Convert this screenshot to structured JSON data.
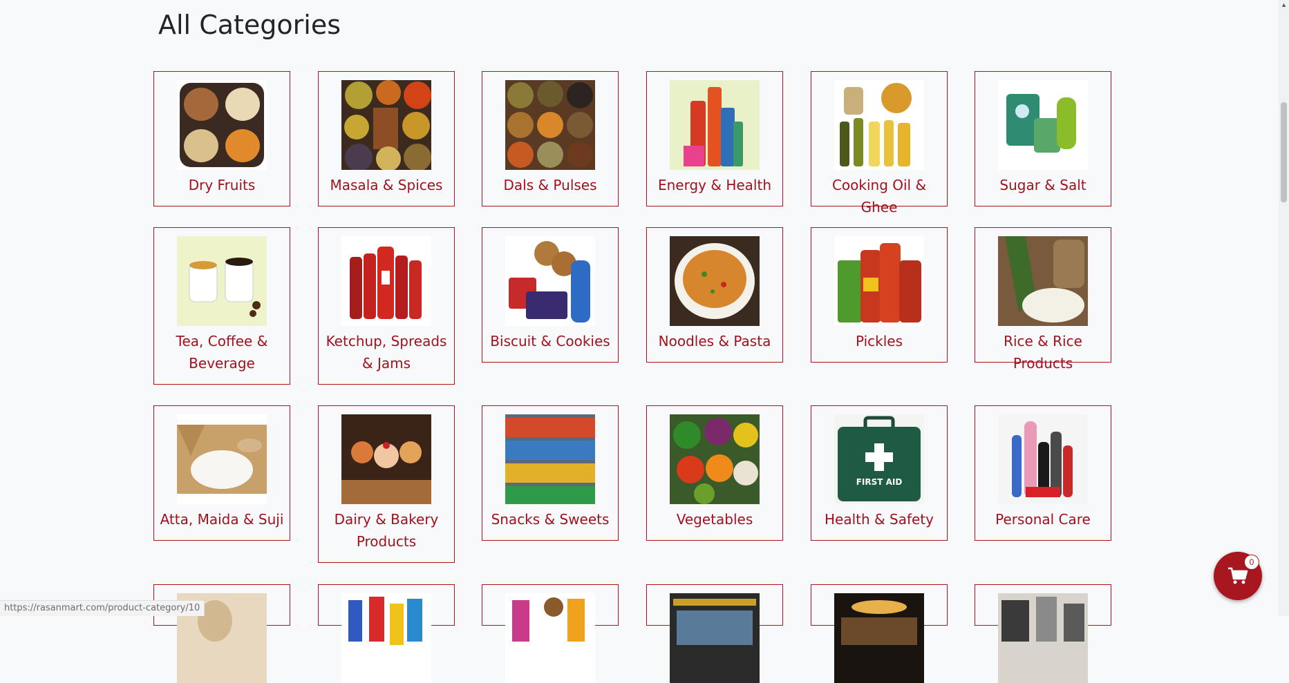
{
  "page": {
    "title": "All Categories"
  },
  "categories": [
    {
      "label": "Dry Fruits",
      "image": "dry-fruits-image"
    },
    {
      "label": "Masala & Spices",
      "image": "spices-image"
    },
    {
      "label": "Dals & Pulses",
      "image": "pulses-image"
    },
    {
      "label": "Energy & Health",
      "image": "energy-drinks-image"
    },
    {
      "label": "Cooking Oil & Ghee",
      "image": "oil-bottles-image"
    },
    {
      "label": "Sugar & Salt",
      "image": "sugar-packs-image"
    },
    {
      "label": "Tea, Coffee & Beverage",
      "image": "coffee-cups-image"
    },
    {
      "label": "Ketchup, Spreads & Jams",
      "image": "ketchup-bottles-image"
    },
    {
      "label": "Biscuit & Cookies",
      "image": "biscuits-image"
    },
    {
      "label": "Noodles & Pasta",
      "image": "noodles-bowl-image"
    },
    {
      "label": "Pickles",
      "image": "pickle-jars-image"
    },
    {
      "label": "Rice & Rice Products",
      "image": "rice-sack-image"
    },
    {
      "label": "Atta, Maida & Suji",
      "image": "flour-bowl-image"
    },
    {
      "label": "Dairy & Bakery Products",
      "image": "pastries-image"
    },
    {
      "label": "Snacks & Sweets",
      "image": "snack-shelves-image"
    },
    {
      "label": "Vegetables",
      "image": "vegetables-image"
    },
    {
      "label": "Health & Safety",
      "image": "first-aid-kit-image"
    },
    {
      "label": "Personal Care",
      "image": "toiletries-image"
    }
  ],
  "first_aid_text": "FIRST AID",
  "cart": {
    "count": "0",
    "icon": "cart-icon"
  },
  "status_bar": {
    "url": "https://rasanmart.com/product-category/10"
  },
  "colors": {
    "accent": "#a0111d",
    "border": "#b1101c",
    "background": "#f8f9fa"
  }
}
